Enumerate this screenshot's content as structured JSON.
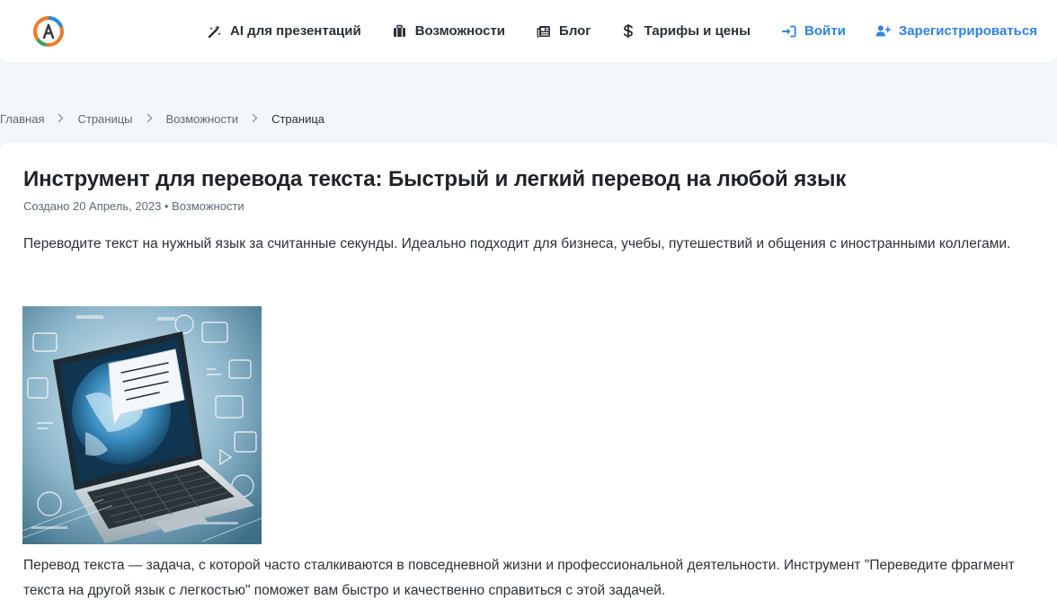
{
  "header": {
    "logo_icon": "logo-letter-a-icon",
    "nav": [
      {
        "label": "AI для презентаций",
        "icon": "magic-wand-icon"
      },
      {
        "label": "Возможности",
        "icon": "briefcase-icon"
      },
      {
        "label": "Блог",
        "icon": "newspaper-icon"
      },
      {
        "label": "Тарифы и цены",
        "icon": "dollar-icon"
      },
      {
        "label": "Войти",
        "icon": "sign-in-icon"
      },
      {
        "label": "Зарегистрироваться",
        "icon": "user-plus-icon"
      }
    ],
    "accent_color": "#2f82e8"
  },
  "breadcrumb": {
    "items": [
      "Главная",
      "Страницы",
      "Возможности"
    ],
    "current": "Страница"
  },
  "article": {
    "title": "Инструмент для перевода текста: Быстрый и легкий перевод на любой язык",
    "meta_date": "Создано 20 Апрель, 2023",
    "meta_separator": "•",
    "meta_category": "Возможности",
    "lead": "Переводите текст на нужный язык за считанные секунды. Идеально подходит для бизнеса, учебы, путешествий и общения с иностранными коллегами.",
    "body": "Перевод текста — задача, с которой часто сталкиваются в повседневной жизни и профессиональной деятельности. Инструмент \"Переведите фрагмент текста на другой язык с легкостью\" поможет вам быстро и качественно справиться с этой задачей."
  }
}
